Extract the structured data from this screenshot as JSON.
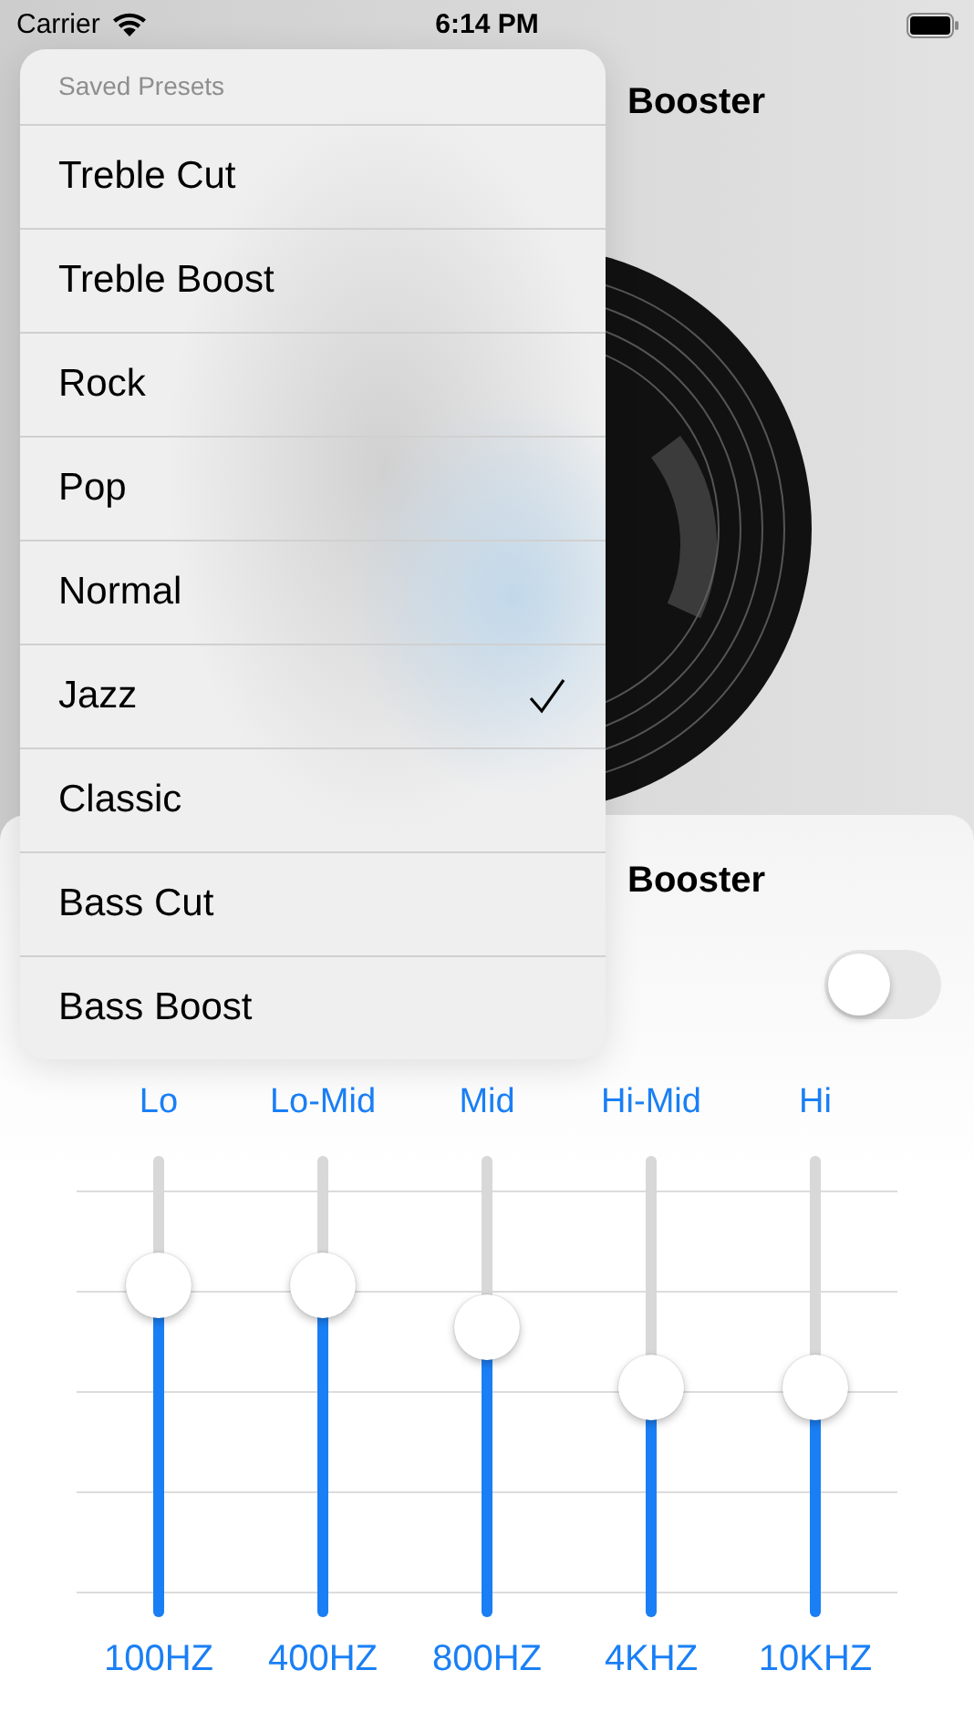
{
  "status_bar": {
    "carrier": "Carrier",
    "time": "6:14 PM"
  },
  "header": {
    "title": "Booster"
  },
  "sheet": {
    "title": "Booster",
    "toggle": {
      "on": false
    }
  },
  "equalizer": {
    "bands": [
      {
        "name": "Lo",
        "frequency": "100HZ",
        "level": 0.72
      },
      {
        "name": "Lo-Mid",
        "frequency": "400HZ",
        "level": 0.72
      },
      {
        "name": "Mid",
        "frequency": "800HZ",
        "level": 0.63
      },
      {
        "name": "Hi-Mid",
        "frequency": "4KHZ",
        "level": 0.5
      },
      {
        "name": "Hi",
        "frequency": "10KHZ",
        "level": 0.5
      }
    ]
  },
  "preset_menu": {
    "header": "Saved Presets",
    "items": [
      {
        "label": "Treble Cut",
        "selected": false
      },
      {
        "label": "Treble Boost",
        "selected": false
      },
      {
        "label": "Rock",
        "selected": false
      },
      {
        "label": "Pop",
        "selected": false
      },
      {
        "label": "Normal",
        "selected": false
      },
      {
        "label": "Jazz",
        "selected": true
      },
      {
        "label": "Classic",
        "selected": false
      },
      {
        "label": "Bass Cut",
        "selected": false
      },
      {
        "label": "Bass Boost",
        "selected": false
      }
    ]
  }
}
